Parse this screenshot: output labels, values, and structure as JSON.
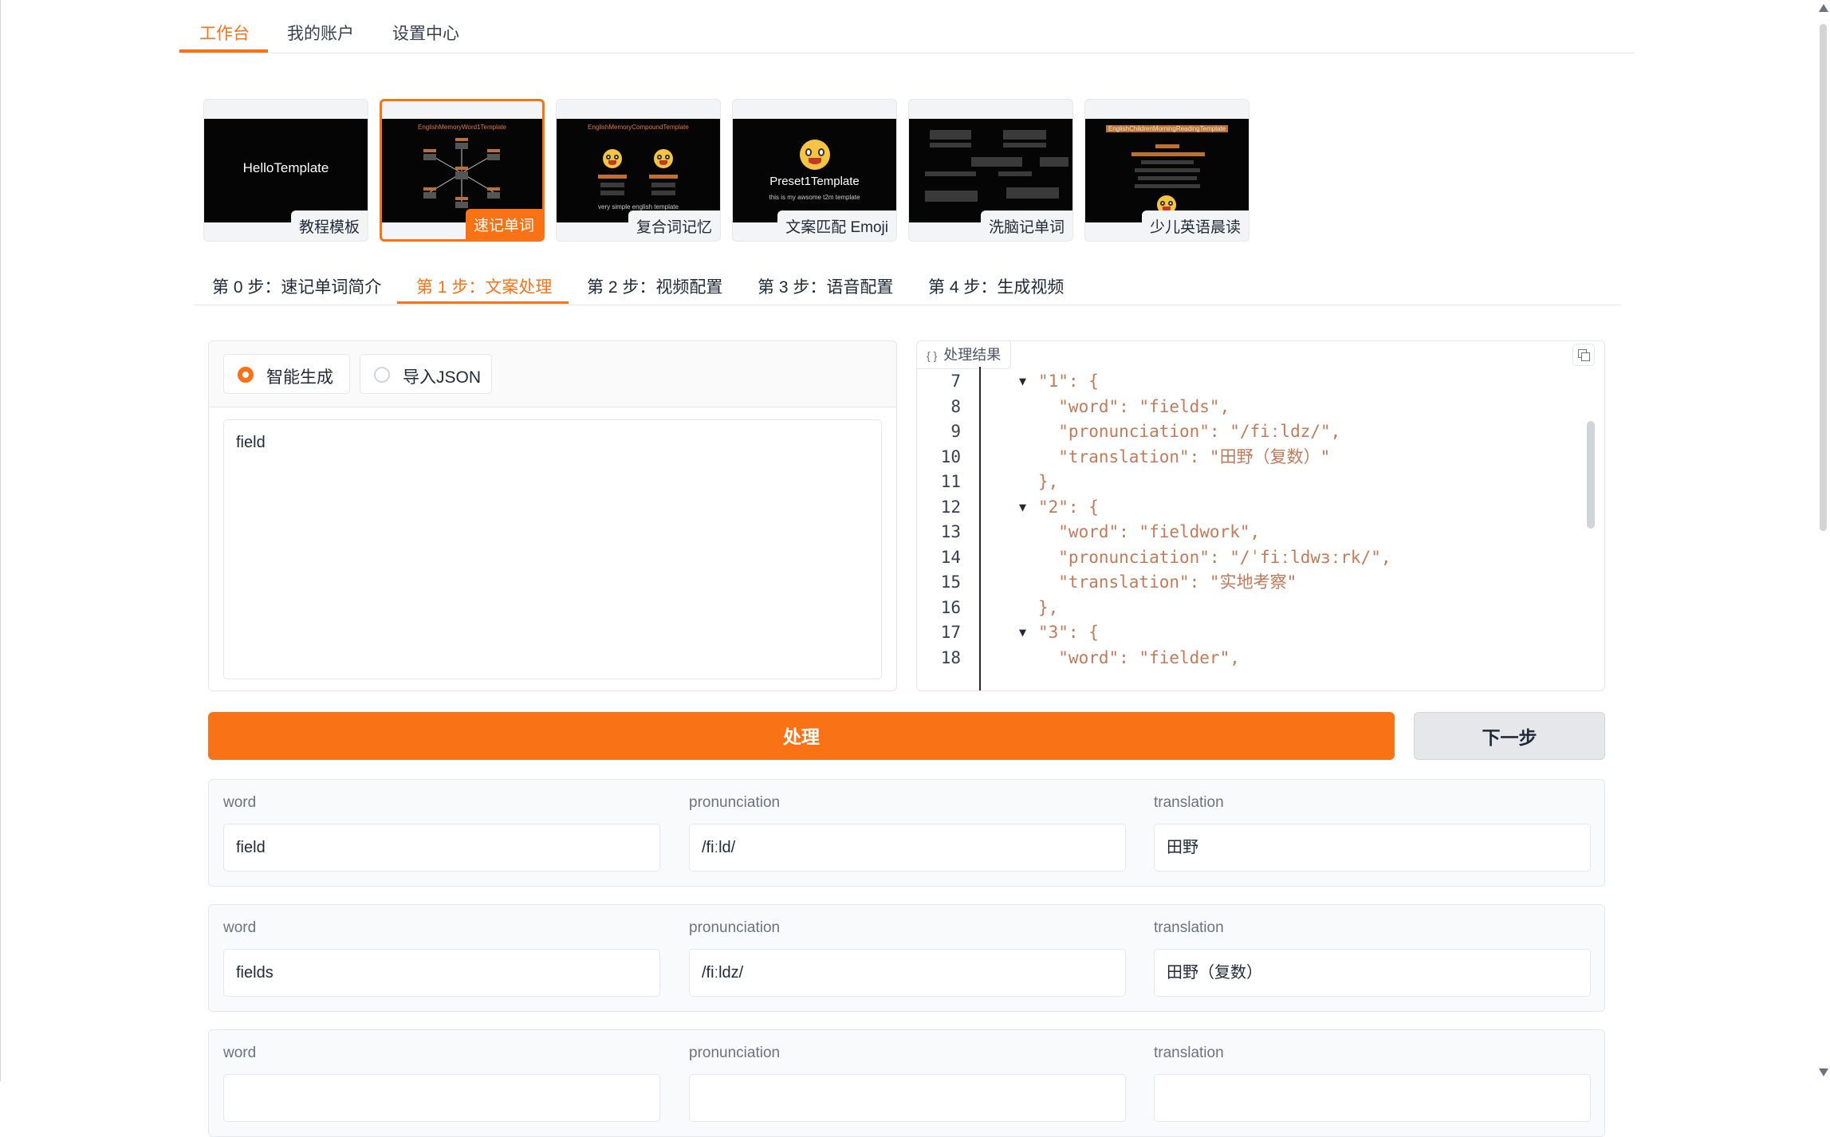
{
  "top_tabs": [
    "工作台",
    "我的账户",
    "设置中心"
  ],
  "templates": [
    {
      "label": "教程模板",
      "thumb_title": "HelloTemplate"
    },
    {
      "label": "速记单词",
      "thumb_title": "EnglishMemoryWord1Template"
    },
    {
      "label": "复合词记忆",
      "thumb_title": "EnglishMemoryCompoundTemplate",
      "thumb_caption": "very simple english template"
    },
    {
      "label": "文案匹配 Emoji",
      "thumb_title": "Preset1Template",
      "thumb_caption": "this is my awsome t2m template"
    },
    {
      "label": "洗脑记单词"
    },
    {
      "label": "少儿英语晨读",
      "thumb_title": "EnglishChildrenMorningReadingTemplate"
    }
  ],
  "selected_template_index": 1,
  "steps": [
    "第 0 步：速记单词简介",
    "第 1 步：文案处理",
    "第 2 步：视频配置",
    "第 3 步：语音配置",
    "第 4 步：生成视频"
  ],
  "active_step_index": 1,
  "input_mode": {
    "options": [
      "智能生成",
      "导入JSON"
    ],
    "selected": "智能生成"
  },
  "input_text": "field",
  "code_panel": {
    "label": "处理结果",
    "lines": [
      {
        "n": "7",
        "fold": true,
        "text": "\"1\": {"
      },
      {
        "n": "8",
        "fold": false,
        "text": "  \"word\": \"fields\","
      },
      {
        "n": "9",
        "fold": false,
        "text": "  \"pronunciation\": \"/fiːldz/\","
      },
      {
        "n": "10",
        "fold": false,
        "text": "  \"translation\": \"田野（复数）\""
      },
      {
        "n": "11",
        "fold": false,
        "text": "},"
      },
      {
        "n": "12",
        "fold": true,
        "text": "\"2\": {"
      },
      {
        "n": "13",
        "fold": false,
        "text": "  \"word\": \"fieldwork\","
      },
      {
        "n": "14",
        "fold": false,
        "text": "  \"pronunciation\": \"/ˈfiːldwɜːrk/\","
      },
      {
        "n": "15",
        "fold": false,
        "text": "  \"translation\": \"实地考察\""
      },
      {
        "n": "16",
        "fold": false,
        "text": "},"
      },
      {
        "n": "17",
        "fold": true,
        "text": "\"3\": {"
      },
      {
        "n": "18",
        "fold": false,
        "text": "  \"word\": \"fielder\","
      }
    ]
  },
  "buttons": {
    "process": "处理",
    "next": "下一步"
  },
  "field_labels": {
    "word": "word",
    "pronunciation": "pronunciation",
    "translation": "translation"
  },
  "words": [
    {
      "word": "field",
      "pronunciation": "/fiːld/",
      "translation": "田野"
    },
    {
      "word": "fields",
      "pronunciation": "/fiːldz/",
      "translation": "田野（复数）"
    },
    {
      "word": "",
      "pronunciation": "",
      "translation": ""
    }
  ]
}
